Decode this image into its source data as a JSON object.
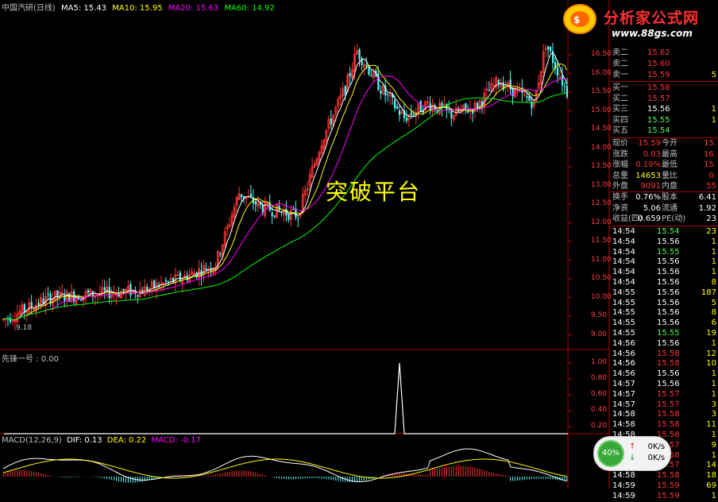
{
  "colors": {
    "up": "#ff3232",
    "down": "#54fcfc",
    "ma5": "#ffffff",
    "ma10": "#ffff00",
    "ma20": "#ff00ff",
    "ma60": "#00ff00",
    "price_green": "#54fc54",
    "yellow": "#ffff00"
  },
  "price_header": {
    "title": "中国汽研(日线)",
    "ma5": "MA5: 15.43",
    "ma10": "MA10: 15.95",
    "ma20": "MA20: 15.63",
    "ma60": "MA60: 14.92"
  },
  "price_axis": [
    "16.50",
    "16.00",
    "15.50",
    "15.00",
    "14.50",
    "14.00",
    "13.50",
    "13.00",
    "12.50",
    "12.00",
    "11.50",
    "11.00",
    "10.50",
    "10.00",
    "9.50",
    "9.00"
  ],
  "low_mark": "9.18",
  "overlay_label": "突破平台",
  "indicator": {
    "header": "先锋一号 : 0.00",
    "axis": [
      "1.00",
      "0.80",
      "0.60",
      "0.40",
      "0.20"
    ]
  },
  "macd": {
    "header": "MACD(12,26,9)",
    "dif": "DIF: 0.13",
    "dea": "DEA: 0.22",
    "macd": "MACD: -0.17"
  },
  "logo": {
    "title": "分析家公式网",
    "url": "www.88gs.com"
  },
  "order_book": {
    "sells": [
      {
        "label": "卖二",
        "price": "15.62"
      },
      {
        "label": "卖二",
        "price": "15.60"
      },
      {
        "label": "卖一",
        "price": "15.59",
        "vol": "5"
      }
    ],
    "buys": [
      {
        "label": "买一",
        "price": "15.58"
      },
      {
        "label": "买二",
        "price": "15.57"
      },
      {
        "label": "买三",
        "price": "15.56",
        "vol": "1"
      },
      {
        "label": "买四",
        "price": "15.55",
        "vol": "1"
      },
      {
        "label": "买五",
        "price": "15.54"
      }
    ]
  },
  "quote": [
    {
      "l1": "现价",
      "v1": "15.59",
      "l2": "今开",
      "v2": "15."
    },
    {
      "l1": "涨跌",
      "v1": "0.03",
      "l2": "最高",
      "v2": "16."
    },
    {
      "l1": "涨幅",
      "v1": "0.19%",
      "l2": "最低",
      "v2": "15."
    },
    {
      "l1": "总量",
      "v1": "14653",
      "l2": "量比",
      "v2": "0."
    },
    {
      "l1": "外盘",
      "v1": "9091",
      "l2": "内盘",
      "v2": "55"
    }
  ],
  "fundamentals": [
    {
      "l1": "换手",
      "v1": "0.76%",
      "l2": "股本",
      "v2": "6.41"
    },
    {
      "l1": "净资",
      "v1": "5.06",
      "l2": "流通",
      "v2": "1.92"
    },
    {
      "l1": "收益(四)",
      "v1": "0.659",
      "l2": "PE(动)",
      "v2": "23"
    }
  ],
  "ticks": [
    {
      "t": "14:54",
      "p": "15.54",
      "v": "23"
    },
    {
      "t": "14:54",
      "p": "15.56",
      "v": "1"
    },
    {
      "t": "14:54",
      "p": "15.55",
      "v": "1"
    },
    {
      "t": "14:54",
      "p": "15.56",
      "v": "1"
    },
    {
      "t": "14:54",
      "p": "15.56",
      "v": "1"
    },
    {
      "t": "14:54",
      "p": "15.56",
      "v": "8"
    },
    {
      "t": "14:55",
      "p": "15.56",
      "v": "187"
    },
    {
      "t": "14:55",
      "p": "15.56",
      "v": "5"
    },
    {
      "t": "14:55",
      "p": "15.56",
      "v": "8"
    },
    {
      "t": "14:55",
      "p": "15.56",
      "v": "6"
    },
    {
      "t": "14:55",
      "p": "15.55",
      "v": "19"
    },
    {
      "t": "14:56",
      "p": "15.56",
      "v": "1"
    },
    {
      "t": "14:56",
      "p": "15.58",
      "v": "12"
    },
    {
      "t": "14:56",
      "p": "15.58",
      "v": "10"
    },
    {
      "t": "14:56",
      "p": "15.56",
      "v": "1"
    },
    {
      "t": "14:57",
      "p": "15.56",
      "v": "1"
    },
    {
      "t": "14:57",
      "p": "15.57",
      "v": "1"
    },
    {
      "t": "14:57",
      "p": "15.57",
      "v": "3"
    },
    {
      "t": "14:58",
      "p": "15.58",
      "v": "3"
    },
    {
      "t": "14:58",
      "p": "15.58",
      "v": "11"
    },
    {
      "t": "14:58",
      "p": "15.58",
      "v": "1"
    },
    {
      "t": "14:58",
      "p": "15.57",
      "v": "9"
    },
    {
      "t": "14:58",
      "p": "15.58",
      "v": "1"
    },
    {
      "t": "14:58",
      "p": "15.57",
      "v": "14"
    },
    {
      "t": "14:58",
      "p": "15.58",
      "v": "18"
    },
    {
      "t": "14:59",
      "p": "15.59",
      "v": "69"
    },
    {
      "t": "14:59",
      "p": "15.59",
      "v": "1"
    }
  ],
  "network": {
    "percent": "40%",
    "up": "0K/s",
    "down": "0K/s"
  }
}
